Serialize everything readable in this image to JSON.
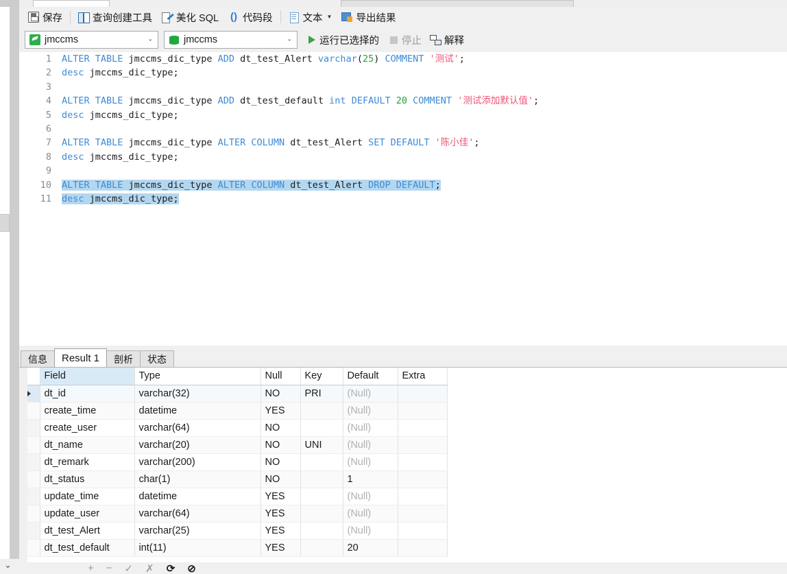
{
  "toolbar": {
    "items": [
      {
        "label": "保存",
        "icon": "save-icon"
      },
      {
        "label": "查询创建工具",
        "icon": "query-builder-icon"
      },
      {
        "label": "美化 SQL",
        "icon": "beautify-sql-icon"
      },
      {
        "label": "代码段",
        "icon": "code-snippet-icon"
      },
      {
        "label": "文本",
        "icon": "text-document-icon"
      },
      {
        "label": "导出结果",
        "icon": "export-result-icon"
      }
    ]
  },
  "connection_bar": {
    "connection": {
      "value": "jmccms",
      "icon": "connection-icon"
    },
    "database": {
      "value": "jmccms",
      "icon": "database-icon"
    },
    "run_selected_label": "运行已选择的",
    "stop_label": "停止",
    "explain_label": "解释"
  },
  "editor": {
    "lines": [
      {
        "n": "1",
        "selected": false,
        "tokens": [
          {
            "t": "ALTER",
            "c": "kw"
          },
          {
            "t": " ",
            "c": "pun"
          },
          {
            "t": "TABLE",
            "c": "kw"
          },
          {
            "t": " jmccms_dic_type ",
            "c": "pun"
          },
          {
            "t": "ADD",
            "c": "kw"
          },
          {
            "t": " dt_test_Alert ",
            "c": "pun"
          },
          {
            "t": "varchar",
            "c": "kw"
          },
          {
            "t": "(",
            "c": "pun"
          },
          {
            "t": "25",
            "c": "num"
          },
          {
            "t": ") ",
            "c": "pun"
          },
          {
            "t": "COMMENT",
            "c": "kw"
          },
          {
            "t": " ",
            "c": "pun"
          },
          {
            "t": "'测试'",
            "c": "str"
          },
          {
            "t": ";",
            "c": "pun"
          }
        ]
      },
      {
        "n": "2",
        "selected": false,
        "tokens": [
          {
            "t": "desc",
            "c": "kw"
          },
          {
            "t": " jmccms_dic_type;",
            "c": "pun"
          }
        ]
      },
      {
        "n": "3",
        "selected": false,
        "tokens": []
      },
      {
        "n": "4",
        "selected": false,
        "tokens": [
          {
            "t": "ALTER",
            "c": "kw"
          },
          {
            "t": " ",
            "c": "pun"
          },
          {
            "t": "TABLE",
            "c": "kw"
          },
          {
            "t": " jmccms_dic_type ",
            "c": "pun"
          },
          {
            "t": "ADD",
            "c": "kw"
          },
          {
            "t": " dt_test_default ",
            "c": "pun"
          },
          {
            "t": "int",
            "c": "kw"
          },
          {
            "t": " ",
            "c": "pun"
          },
          {
            "t": "DEFAULT",
            "c": "kw"
          },
          {
            "t": " ",
            "c": "pun"
          },
          {
            "t": "20",
            "c": "num"
          },
          {
            "t": " ",
            "c": "pun"
          },
          {
            "t": "COMMENT",
            "c": "kw"
          },
          {
            "t": " ",
            "c": "pun"
          },
          {
            "t": "'测试添加默认值'",
            "c": "str"
          },
          {
            "t": ";",
            "c": "pun"
          }
        ]
      },
      {
        "n": "5",
        "selected": false,
        "tokens": [
          {
            "t": "desc",
            "c": "kw"
          },
          {
            "t": " jmccms_dic_type;",
            "c": "pun"
          }
        ]
      },
      {
        "n": "6",
        "selected": false,
        "tokens": []
      },
      {
        "n": "7",
        "selected": false,
        "tokens": [
          {
            "t": "ALTER",
            "c": "kw"
          },
          {
            "t": " ",
            "c": "pun"
          },
          {
            "t": "TABLE",
            "c": "kw"
          },
          {
            "t": " jmccms_dic_type ",
            "c": "pun"
          },
          {
            "t": "ALTER",
            "c": "kw"
          },
          {
            "t": " ",
            "c": "pun"
          },
          {
            "t": "COLUMN",
            "c": "kw"
          },
          {
            "t": " dt_test_Alert ",
            "c": "pun"
          },
          {
            "t": "SET",
            "c": "kw"
          },
          {
            "t": " ",
            "c": "pun"
          },
          {
            "t": "DEFAULT",
            "c": "kw"
          },
          {
            "t": " ",
            "c": "pun"
          },
          {
            "t": "'陈小佳'",
            "c": "str"
          },
          {
            "t": ";",
            "c": "pun"
          }
        ]
      },
      {
        "n": "8",
        "selected": false,
        "tokens": [
          {
            "t": "desc",
            "c": "kw"
          },
          {
            "t": " jmccms_dic_type;",
            "c": "pun"
          }
        ]
      },
      {
        "n": "9",
        "selected": false,
        "tokens": []
      },
      {
        "n": "10",
        "selected": true,
        "tokens": [
          {
            "t": "ALTER",
            "c": "kw"
          },
          {
            "t": " ",
            "c": "pun"
          },
          {
            "t": "TABLE",
            "c": "kw"
          },
          {
            "t": " jmccms_dic_type ",
            "c": "pun"
          },
          {
            "t": "ALTER",
            "c": "kw"
          },
          {
            "t": " ",
            "c": "pun"
          },
          {
            "t": "COLUMN",
            "c": "kw"
          },
          {
            "t": " dt_test_Alert ",
            "c": "pun"
          },
          {
            "t": "DROP",
            "c": "kw"
          },
          {
            "t": " ",
            "c": "pun"
          },
          {
            "t": "DEFAULT",
            "c": "kw"
          },
          {
            "t": ";",
            "c": "pun"
          }
        ]
      },
      {
        "n": "11",
        "selected": true,
        "tokens": [
          {
            "t": "desc",
            "c": "kw"
          },
          {
            "t": " jmccms_dic_type;",
            "c": "pun"
          }
        ]
      }
    ]
  },
  "results": {
    "tabs": [
      {
        "label": "信息",
        "active": false
      },
      {
        "label": "Result 1",
        "active": true
      },
      {
        "label": "剖析",
        "active": false
      },
      {
        "label": "状态",
        "active": false
      }
    ],
    "columns": [
      "Field",
      "Type",
      "Null",
      "Key",
      "Default",
      "Extra"
    ],
    "selected_column": "Field",
    "null_text": "(Null)",
    "rows": [
      {
        "current": true,
        "field": "dt_id",
        "type": "varchar(32)",
        "null": "NO",
        "key": "PRI",
        "default": "(Null)",
        "extra": ""
      },
      {
        "current": false,
        "field": "create_time",
        "type": "datetime",
        "null": "YES",
        "key": "",
        "default": "(Null)",
        "extra": ""
      },
      {
        "current": false,
        "field": "create_user",
        "type": "varchar(64)",
        "null": "NO",
        "key": "",
        "default": "(Null)",
        "extra": ""
      },
      {
        "current": false,
        "field": "dt_name",
        "type": "varchar(20)",
        "null": "NO",
        "key": "UNI",
        "default": "(Null)",
        "extra": ""
      },
      {
        "current": false,
        "field": "dt_remark",
        "type": "varchar(200)",
        "null": "NO",
        "key": "",
        "default": "(Null)",
        "extra": ""
      },
      {
        "current": false,
        "field": "dt_status",
        "type": "char(1)",
        "null": "NO",
        "key": "",
        "default": "1",
        "extra": ""
      },
      {
        "current": false,
        "field": "update_time",
        "type": "datetime",
        "null": "YES",
        "key": "",
        "default": "(Null)",
        "extra": ""
      },
      {
        "current": false,
        "field": "update_user",
        "type": "varchar(64)",
        "null": "YES",
        "key": "",
        "default": "(Null)",
        "extra": ""
      },
      {
        "current": false,
        "field": "dt_test_Alert",
        "type": "varchar(25)",
        "null": "YES",
        "key": "",
        "default": "(Null)",
        "extra": ""
      },
      {
        "current": false,
        "field": "dt_test_default",
        "type": "int(11)",
        "null": "YES",
        "key": "",
        "default": "20",
        "extra": ""
      }
    ]
  },
  "bottom_nav": {
    "buttons": [
      "+",
      "−",
      "✓",
      "✗",
      "⟳",
      "⊘"
    ]
  },
  "colors": {
    "keyword": "#3d8bd6",
    "string": "#ee5577",
    "number": "#22a03c",
    "selection": "#b4d7f0",
    "header_selected": "#d9eaf7",
    "chrome": "#f0f0f0"
  }
}
